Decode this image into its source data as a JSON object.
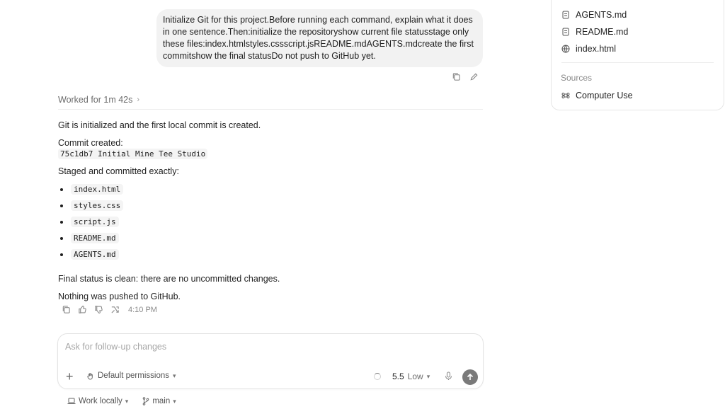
{
  "user_message": "Initialize Git for this project.Before running each command, explain what it does in one sentence.Then:initialize the repositoryshow current file statusstage only these files:index.htmlstyles.cssscript.jsREADME.mdAGENTS.mdcreate the first commitshow the final statusDo not push to GitHub yet.",
  "worked_label": "Worked for 1m 42s",
  "answer": {
    "intro": "Git is initialized and the first local commit is created.",
    "commit_label": "Commit created:",
    "commit_value": "75c1db7 Initial Mine Tee Studio",
    "staged_label": "Staged and committed exactly:",
    "files": [
      "index.html",
      "styles.css",
      "script.js",
      "README.md",
      "AGENTS.md"
    ],
    "final_status": "Final status is clean: there are no uncommitted changes.",
    "push_note": "Nothing was pushed to GitHub."
  },
  "message_time": "4:10 PM",
  "composer": {
    "placeholder": "Ask for follow-up changes",
    "permissions": "Default permissions",
    "model_version": "5.5",
    "model_effort": "Low"
  },
  "footer": {
    "work_mode": "Work locally",
    "branch": "main"
  },
  "panel": {
    "files": [
      "AGENTS.md",
      "README.md",
      "index.html"
    ],
    "sources_label": "Sources",
    "sources": [
      "Computer Use"
    ]
  }
}
